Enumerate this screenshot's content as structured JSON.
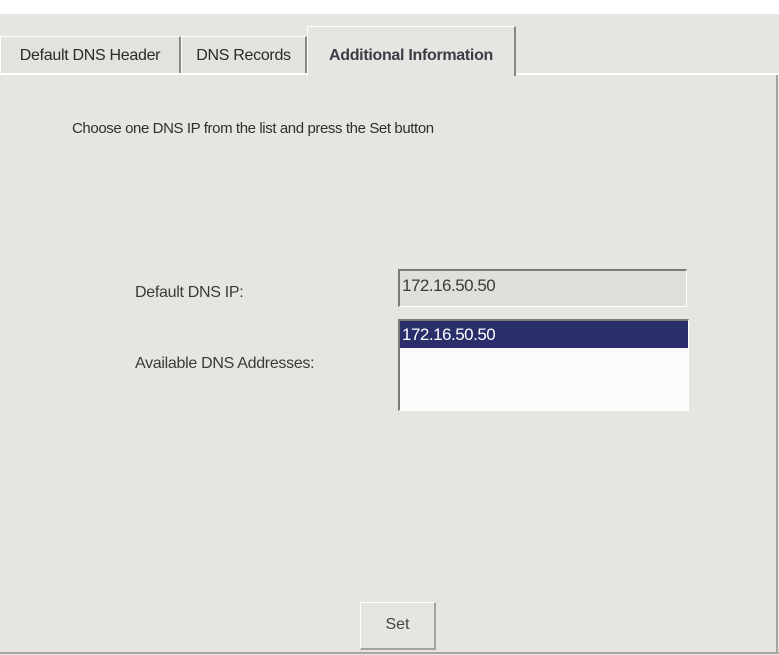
{
  "tabs": [
    {
      "label": "Default DNS Header",
      "active": false
    },
    {
      "label": "DNS Records",
      "active": false
    },
    {
      "label": "Additional Information",
      "active": true
    }
  ],
  "instruction": "Choose one DNS IP from the list and press the Set button",
  "form": {
    "default_dns_label": "Default DNS IP:",
    "default_dns_value": "172.16.50.50",
    "available_label": "Available DNS Addresses:",
    "available_items": [
      {
        "value": "172.16.50.50",
        "selected": true
      }
    ]
  },
  "set_button": "Set",
  "colors": {
    "panel": "#e7e5e1",
    "selection": "#2a2e6a"
  }
}
